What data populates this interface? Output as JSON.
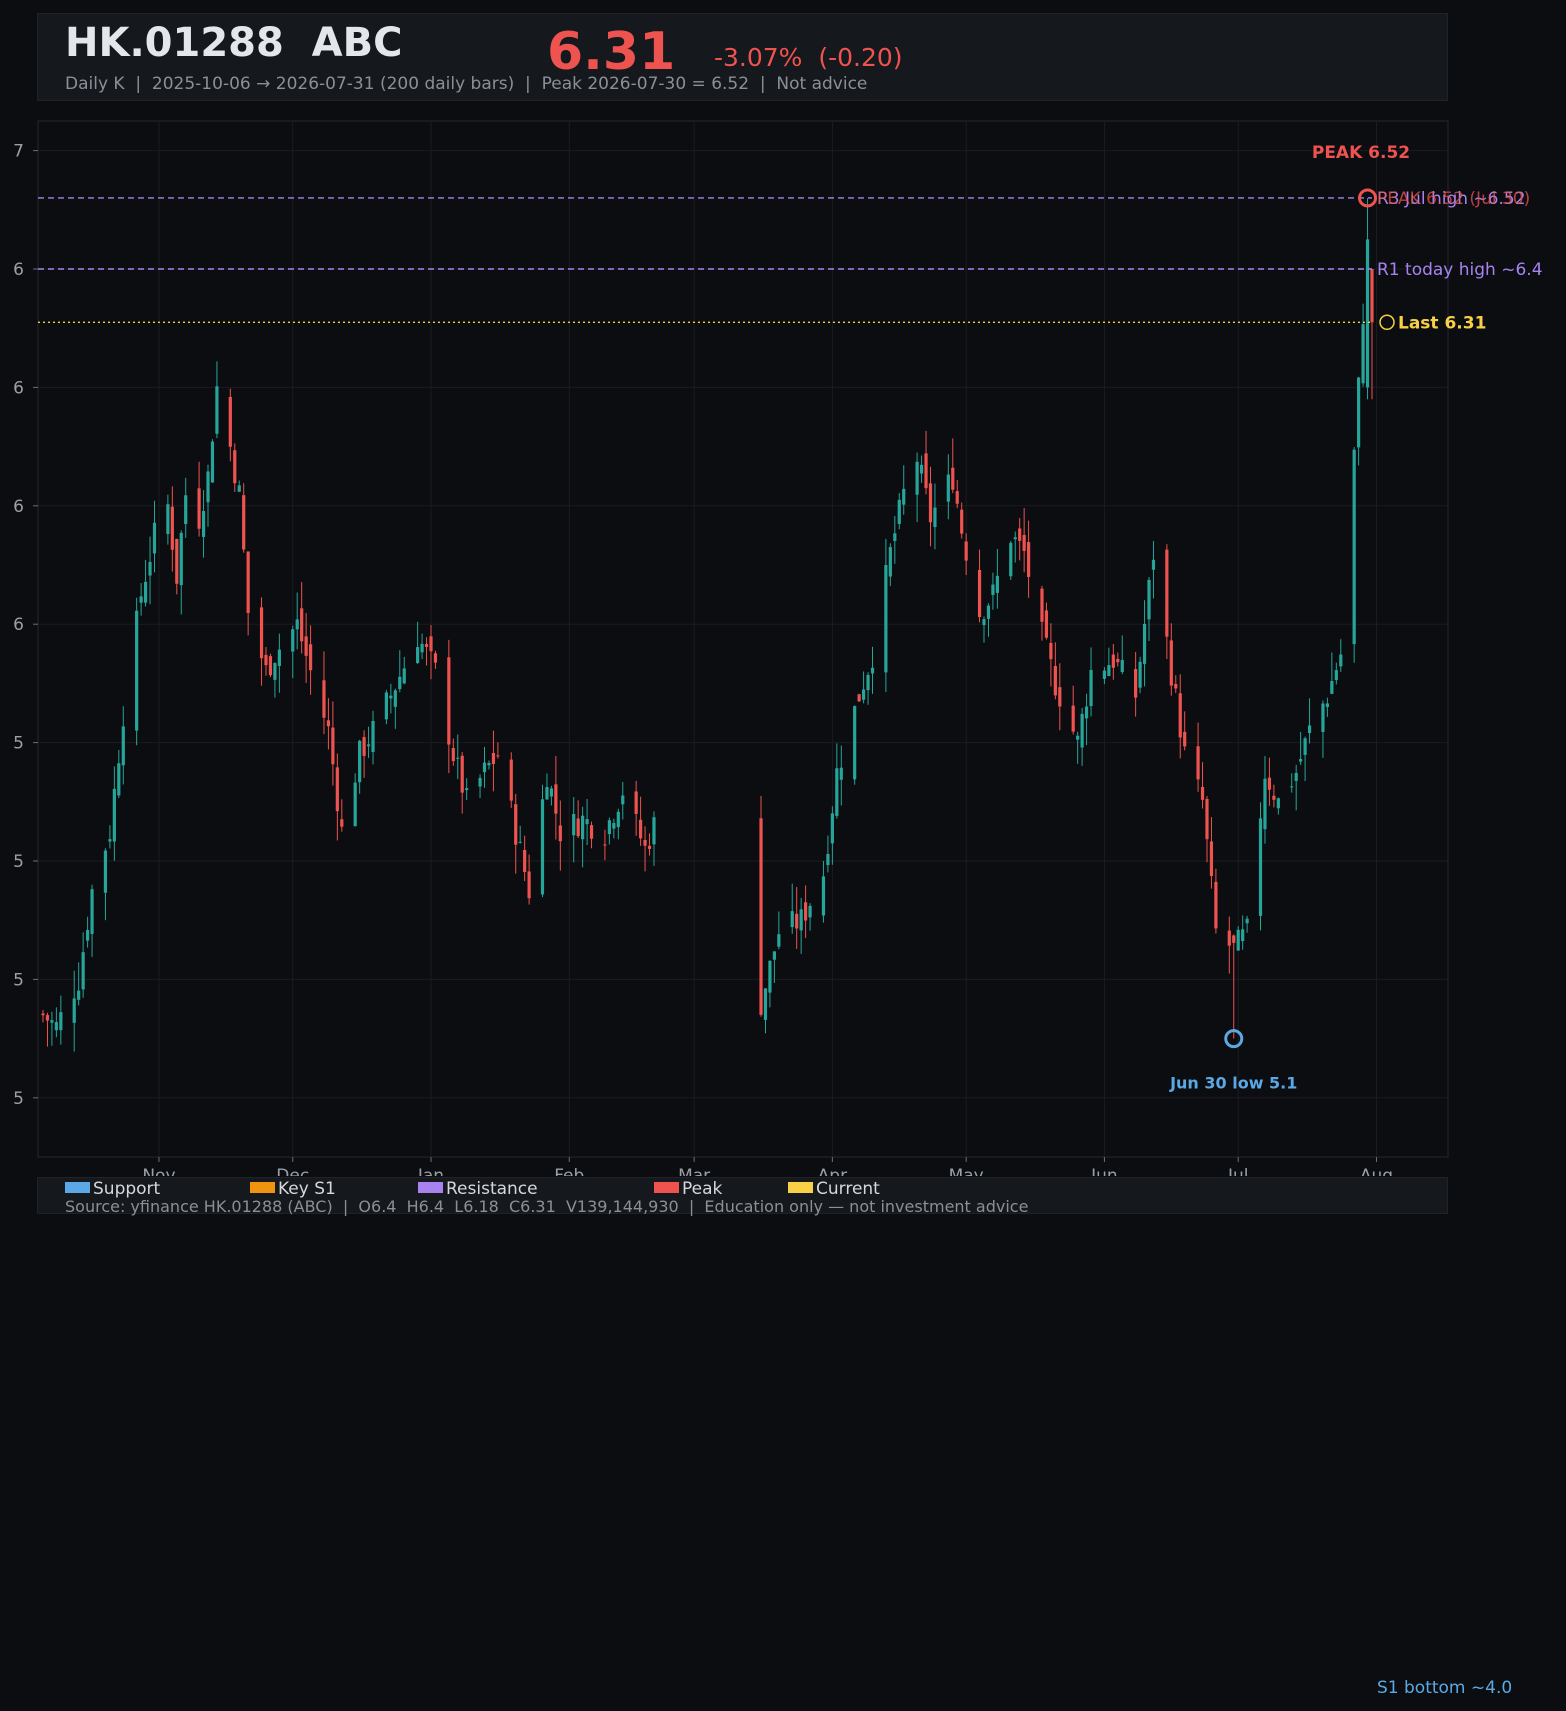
{
  "header": {
    "ticker": "HK.01288  ABC",
    "price": "6.31",
    "change": "-3.07%  (-0.20)",
    "subtitle": "Daily K  |  2025-10-06 → 2026-07-31 (200 daily bars)  |  Peak 2026-07-30 = 6.52  |  Not advice"
  },
  "legend": {
    "items": [
      {
        "label": "Support",
        "color": "#5aa9e6"
      },
      {
        "label": "Key S1",
        "color": "#f0930f"
      },
      {
        "label": "Resistance",
        "color": "#a883f0"
      },
      {
        "label": "Peak",
        "color": "#ef5350"
      },
      {
        "label": "Current",
        "color": "#f7d046"
      }
    ],
    "source": "Source: yfinance HK.01288 (ABC)  |  O6.4  H6.4  L6.18  C6.31  V139,144,930  |  Education only — not investment advice"
  },
  "footer": {
    "s1_bottom": "S1 bottom ~4.0"
  },
  "colors": {
    "up": "#26a69a",
    "down": "#ef5350",
    "resistance": "#a883f0",
    "current": "#f7d046",
    "support": "#5aa9e6",
    "peak": "#ef5350",
    "grid": "#1a1d21",
    "axis_text": "#9aa0a6"
  },
  "chart_data": {
    "type": "candlestick",
    "title": "HK.01288  ABC",
    "x_start": "2025-10-06",
    "x_end": "2026-07-31",
    "bar_count": 200,
    "ylim": [
      4.9,
      6.65
    ],
    "y_tick_values": [
      5.0,
      5.2,
      5.4,
      5.6,
      5.8,
      6.0,
      6.2,
      6.4,
      6.6
    ],
    "y_tick_labels": [
      "5",
      "5",
      "5",
      "5",
      "6",
      "6",
      "6",
      "6",
      "7"
    ],
    "x_ticks": [
      {
        "date": "2025-11-01",
        "label": "Nov"
      },
      {
        "date": "2025-12-01",
        "label": "Dec"
      },
      {
        "date": "2026-01-01",
        "label": "Jan"
      },
      {
        "date": "2026-02-01",
        "label": "Feb"
      },
      {
        "date": "2026-03-01",
        "label": "Mar"
      },
      {
        "date": "2026-04-01",
        "label": "Apr"
      },
      {
        "date": "2026-05-01",
        "label": "May"
      },
      {
        "date": "2026-06-01",
        "label": "Jun"
      },
      {
        "date": "2026-07-01",
        "label": "Jul"
      },
      {
        "date": "2026-08-01",
        "label": "Aug"
      }
    ],
    "close_anchors": [
      [
        "2025-10-06",
        5.14
      ],
      [
        "2025-10-09",
        5.12
      ],
      [
        "2025-10-14",
        5.2
      ],
      [
        "2025-10-17",
        5.35
      ],
      [
        "2025-10-21",
        5.45
      ],
      [
        "2025-10-24",
        5.65
      ],
      [
        "2025-10-28",
        5.85
      ],
      [
        "2025-10-31",
        5.95
      ],
      [
        "2025-11-03",
        6.0
      ],
      [
        "2025-11-05",
        5.88
      ],
      [
        "2025-11-07",
        6.02
      ],
      [
        "2025-11-10",
        5.98
      ],
      [
        "2025-11-12",
        6.05
      ],
      [
        "2025-11-14",
        6.2
      ],
      [
        "2025-11-17",
        6.1
      ],
      [
        "2025-11-19",
        6.02
      ],
      [
        "2025-11-21",
        5.82
      ],
      [
        "2025-11-25",
        5.72
      ],
      [
        "2025-11-27",
        5.75
      ],
      [
        "2025-12-02",
        5.8
      ],
      [
        "2025-12-05",
        5.72
      ],
      [
        "2025-12-09",
        5.62
      ],
      [
        "2025-12-12",
        5.45
      ],
      [
        "2025-12-16",
        5.58
      ],
      [
        "2025-12-19",
        5.62
      ],
      [
        "2025-12-23",
        5.68
      ],
      [
        "2025-12-29",
        5.78
      ],
      [
        "2026-01-02",
        5.72
      ],
      [
        "2026-01-06",
        5.58
      ],
      [
        "2026-01-09",
        5.5
      ],
      [
        "2026-01-13",
        5.55
      ],
      [
        "2026-01-16",
        5.58
      ],
      [
        "2026-01-20",
        5.45
      ],
      [
        "2026-01-23",
        5.35
      ],
      [
        "2026-01-27",
        5.55
      ],
      [
        "2026-01-30",
        5.45
      ],
      [
        "2026-02-04",
        5.47
      ],
      [
        "2026-02-09",
        5.45
      ],
      [
        "2026-02-13",
        5.52
      ],
      [
        "2026-02-18",
        5.42
      ],
      [
        "2026-02-23",
        5.52
      ],
      [
        "2026-02-27",
        5.4
      ],
      [
        "2026-03-03",
        5.32
      ],
      [
        "2026-03-06",
        5.22
      ],
      [
        "2026-03-11",
        5.25
      ],
      [
        "2026-03-16",
        5.16
      ],
      [
        "2026-03-20",
        5.28
      ],
      [
        "2026-03-25",
        5.3
      ],
      [
        "2026-03-30",
        5.38
      ],
      [
        "2026-04-02",
        5.55
      ],
      [
        "2026-04-07",
        5.68
      ],
      [
        "2026-04-10",
        5.75
      ],
      [
        "2026-04-14",
        5.92
      ],
      [
        "2026-04-17",
        6.02
      ],
      [
        "2026-04-20",
        6.08
      ],
      [
        "2026-04-23",
        5.98
      ],
      [
        "2026-04-28",
        6.05
      ],
      [
        "2026-04-30",
        5.96
      ],
      [
        "2026-05-04",
        5.82
      ],
      [
        "2026-05-07",
        5.85
      ],
      [
        "2026-05-11",
        5.95
      ],
      [
        "2026-05-14",
        5.92
      ],
      [
        "2026-05-18",
        5.78
      ],
      [
        "2026-05-21",
        5.7
      ],
      [
        "2026-05-26",
        5.6
      ],
      [
        "2026-05-29",
        5.72
      ],
      [
        "2026-06-03",
        5.74
      ],
      [
        "2026-06-08",
        5.68
      ],
      [
        "2026-06-12",
        5.92
      ],
      [
        "2026-06-16",
        5.72
      ],
      [
        "2026-06-19",
        5.58
      ],
      [
        "2026-06-23",
        5.5
      ],
      [
        "2026-06-26",
        5.28
      ],
      [
        "2026-06-30",
        5.25
      ],
      [
        "2026-07-03",
        5.28
      ],
      [
        "2026-07-07",
        5.55
      ],
      [
        "2026-07-10",
        5.5
      ],
      [
        "2026-07-14",
        5.55
      ],
      [
        "2026-07-17",
        5.62
      ],
      [
        "2026-07-21",
        5.68
      ],
      [
        "2026-07-24",
        5.75
      ],
      [
        "2026-07-28",
        6.2
      ],
      [
        "2026-07-30",
        6.45
      ],
      [
        "2026-07-31",
        6.31
      ]
    ],
    "levels": [
      {
        "name": "R3 Jul high ~6.52",
        "value": 6.52,
        "kind": "resistance",
        "style": "dashed"
      },
      {
        "name": "R1 today high ~6.4",
        "value": 6.4,
        "kind": "resistance",
        "style": "dashed"
      },
      {
        "name": "Last 6.31",
        "value": 6.31,
        "kind": "current",
        "style": "dotted"
      }
    ],
    "annotations": [
      {
        "date": "2026-07-30",
        "value": 6.52,
        "label": "PEAK 6.52",
        "side_label": "PEAK 6.52 (Jul 30)",
        "kind": "peak"
      },
      {
        "date": "2026-06-30",
        "value": 5.1,
        "label": "Jun 30 low 5.1",
        "kind": "support"
      }
    ]
  }
}
